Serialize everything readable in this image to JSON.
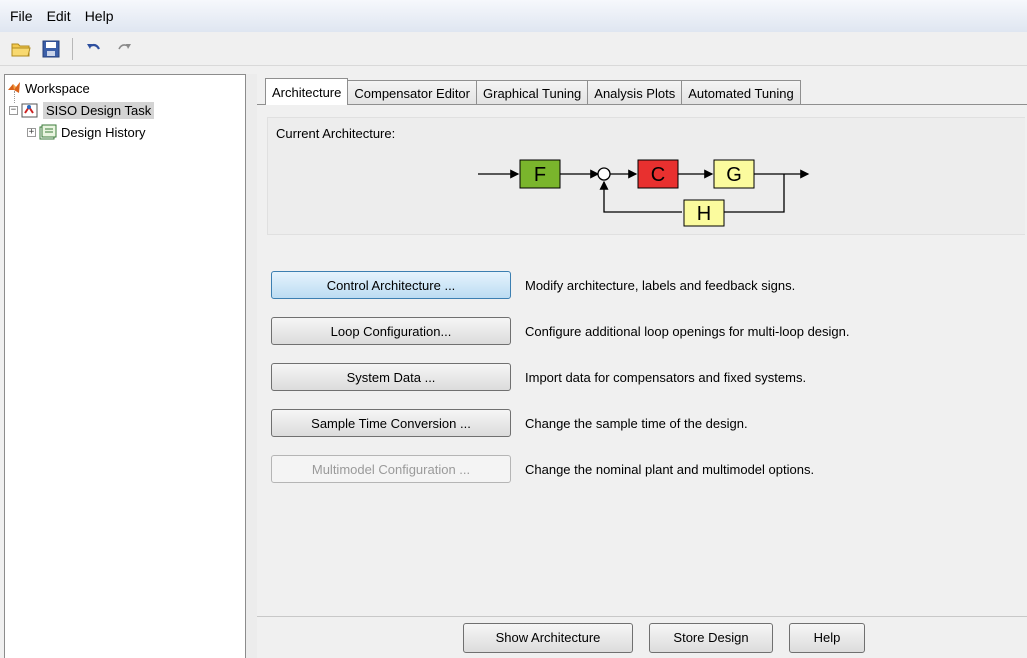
{
  "menu": [
    "File",
    "Edit",
    "Help"
  ],
  "toolbar": {
    "icons": [
      "open-icon",
      "save-icon",
      "undo-icon",
      "redo-icon"
    ]
  },
  "tree": {
    "root": "Workspace",
    "task": "SISO Design Task",
    "history": "Design History"
  },
  "tabs": [
    "Architecture",
    "Compensator Editor",
    "Graphical Tuning",
    "Analysis Plots",
    "Automated Tuning"
  ],
  "architecture": {
    "label": "Current Architecture:",
    "blocks": {
      "F": "F",
      "C": "C",
      "G": "G",
      "H": "H"
    },
    "colors": {
      "F": "#7ab52c",
      "C": "#e8302f",
      "G": "#fbfb9e",
      "H": "#fbfb9e"
    }
  },
  "actions": [
    {
      "button": "Control Architecture ...",
      "description": "Modify architecture, labels and feedback signs."
    },
    {
      "button": "Loop Configuration...",
      "description": "Configure additional loop openings for multi-loop design."
    },
    {
      "button": "System Data ...",
      "description": "Import data for compensators and fixed systems."
    },
    {
      "button": "Sample Time Conversion ...",
      "description": "Change the sample time of the design."
    },
    {
      "button": "Multimodel Configuration ...",
      "description": "Change the nominal plant and multimodel options."
    }
  ],
  "bottom": {
    "show_architecture": "Show Architecture",
    "store_design": "Store Design",
    "help": "Help"
  }
}
